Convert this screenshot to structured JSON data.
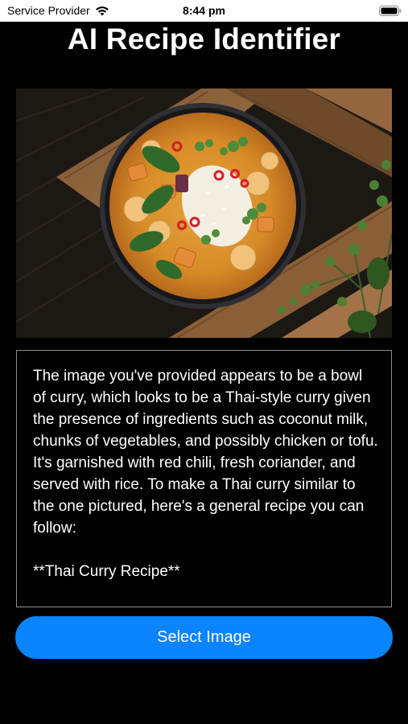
{
  "status_bar": {
    "carrier": "Service Provider",
    "time": "8:44 pm",
    "wifi_icon": "wifi-icon",
    "battery_icon": "battery-icon"
  },
  "header": {
    "title": "AI Recipe Identifier"
  },
  "photo": {
    "icon": "curry-bowl-photo"
  },
  "result": {
    "text": "The image you've provided appears to be a bowl of curry, which looks to be a Thai-style curry given the presence of ingredients such as coconut milk, chunks of vegetables, and possibly chicken or tofu. It's garnished with red chili, fresh coriander, and served with rice. To make a Thai curry similar to the one pictured, here's a general recipe you can follow:\n\n**Thai Curry Recipe**"
  },
  "actions": {
    "select_image_label": "Select Image"
  },
  "colors": {
    "background": "#000000",
    "accent": "#0a84ff",
    "border": "#8e8e93"
  }
}
